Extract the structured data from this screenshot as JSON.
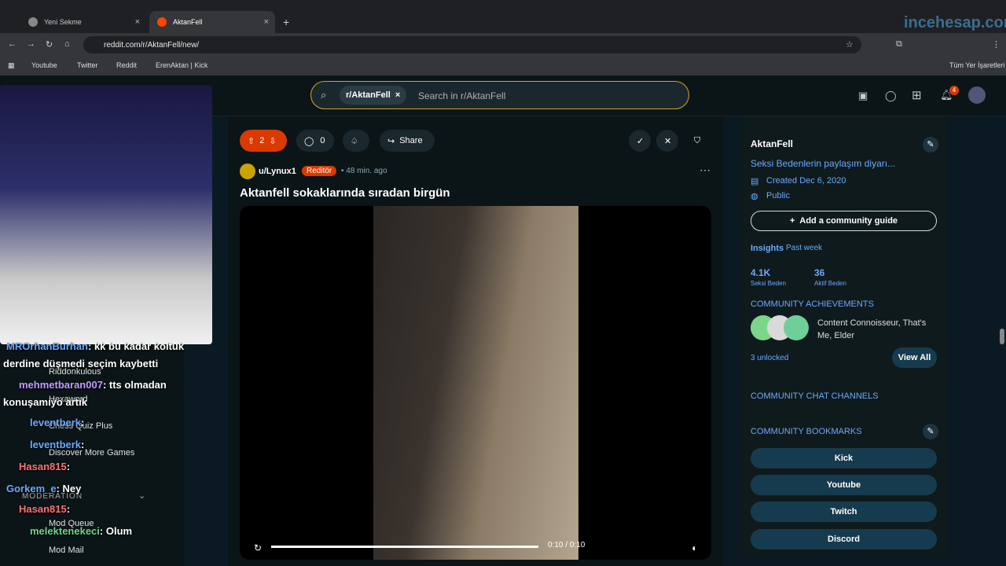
{
  "browser": {
    "tabs": [
      {
        "label": "Yeni Sekme",
        "x_label": "×"
      },
      {
        "label": "AktanFell",
        "x_label": "×"
      }
    ],
    "new_tab": "+",
    "url": "reddit.com/r/AktanFell/new/",
    "bookmarks": [
      "Youtube",
      "Twitter",
      "Reddit",
      "ErenAktan | Kick"
    ],
    "all_bookmarks": "Tüm Yer İşaretleri",
    "watermark": "incehesap.com"
  },
  "reddit": {
    "search": {
      "chip": "r/AktanFell",
      "placeholder": "Search in r/AktanFell"
    },
    "notification_count": "4",
    "post": {
      "votes": "2",
      "comments": "0",
      "share": "Share",
      "author": "u/Lynux1",
      "flair": "Reditör",
      "time": "• 48 min. ago",
      "title": "Aktanfell sokaklarında sıradan birgün",
      "video_time": "0:10 / 0:10"
    },
    "sidebar": {
      "name": "AktanFell",
      "description": "Seksi Bedenlerin paylaşım diyarı...",
      "created": "Created Dec 6, 2020",
      "visibility": "Public",
      "guide_button": "Add a community guide",
      "insights": "Insights",
      "range": "Past week",
      "stats": [
        {
          "value": "4.1K",
          "label": "Seksi Beden"
        },
        {
          "value": "36",
          "label": "Aktif Beden"
        }
      ],
      "achievements_heading": "COMMUNITY ACHIEVEMENTS",
      "achievements_text": "Content Connoisseur, That's Me, Elder",
      "unlocked": "3 unlocked",
      "view_all": "View All",
      "chat_heading": "COMMUNITY CHAT CHANNELS",
      "bookmarks_heading": "COMMUNITY BOOKMARKS",
      "bookmarks": [
        "Kick",
        "Youtube",
        "Twitch",
        "Discord"
      ]
    },
    "left_nav": {
      "items": [
        "Riddonkulous",
        "Hexaword",
        "Chess Quiz Plus",
        "Discover More Games"
      ],
      "moderation": "MODERATION",
      "mod_items": [
        "Mod Queue",
        "Mod Mail"
      ]
    }
  },
  "stream_chat": [
    {
      "user": "MROrhanBurhan",
      "msg": ": kk bu kadar koltuk"
    },
    {
      "user": "",
      "msg": "derdine düşmedi seçim kaybetti"
    },
    {
      "user": "mehmetbaran007",
      "msg": ": tts olmadan"
    },
    {
      "user": "",
      "msg": "konuşamıyo artık"
    },
    {
      "user": "leventberk",
      "msg": ":"
    },
    {
      "user": "leventberk",
      "msg": ":"
    },
    {
      "user": "Hasan815",
      "msg": ":"
    },
    {
      "user": "Gorkem_e",
      "msg": ": Ney"
    },
    {
      "user": "Hasan815",
      "msg": ":"
    },
    {
      "user": "melektenekeci",
      "msg": ": Olum"
    }
  ],
  "colors": {
    "accent": "#d93a00",
    "link": "#6aa9ff",
    "search_border": "#d7a21a"
  }
}
